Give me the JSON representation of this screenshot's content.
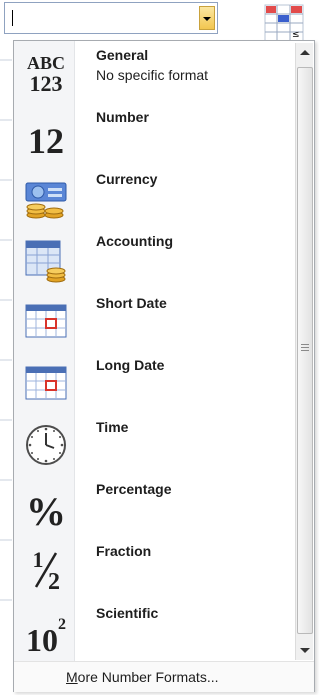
{
  "combo": {
    "value": ""
  },
  "formats": [
    {
      "icon": "general-abc123-icon",
      "label": "General",
      "subtitle": "No specific format",
      "glyph_top": "ABC",
      "glyph_bottom": "123"
    },
    {
      "icon": "number-12-icon",
      "label": "Number",
      "glyph": "12"
    },
    {
      "icon": "currency-icon",
      "label": "Currency"
    },
    {
      "icon": "accounting-icon",
      "label": "Accounting"
    },
    {
      "icon": "short-date-calendar-icon",
      "label": "Short Date"
    },
    {
      "icon": "long-date-calendar-icon",
      "label": "Long Date"
    },
    {
      "icon": "clock-icon",
      "label": "Time"
    },
    {
      "icon": "percent-icon",
      "label": "Percentage",
      "glyph": "%"
    },
    {
      "icon": "fraction-icon",
      "label": "Fraction",
      "glyph_num": "1",
      "glyph_den": "2"
    },
    {
      "icon": "scientific-icon",
      "label": "Scientific",
      "glyph_base": "10",
      "glyph_exp": "2"
    }
  ],
  "footer": {
    "more_label_first": "M",
    "more_label_rest": "ore Number Formats..."
  },
  "colors": {
    "accent": "#f2c650",
    "panel_border": "#a7abb0"
  }
}
